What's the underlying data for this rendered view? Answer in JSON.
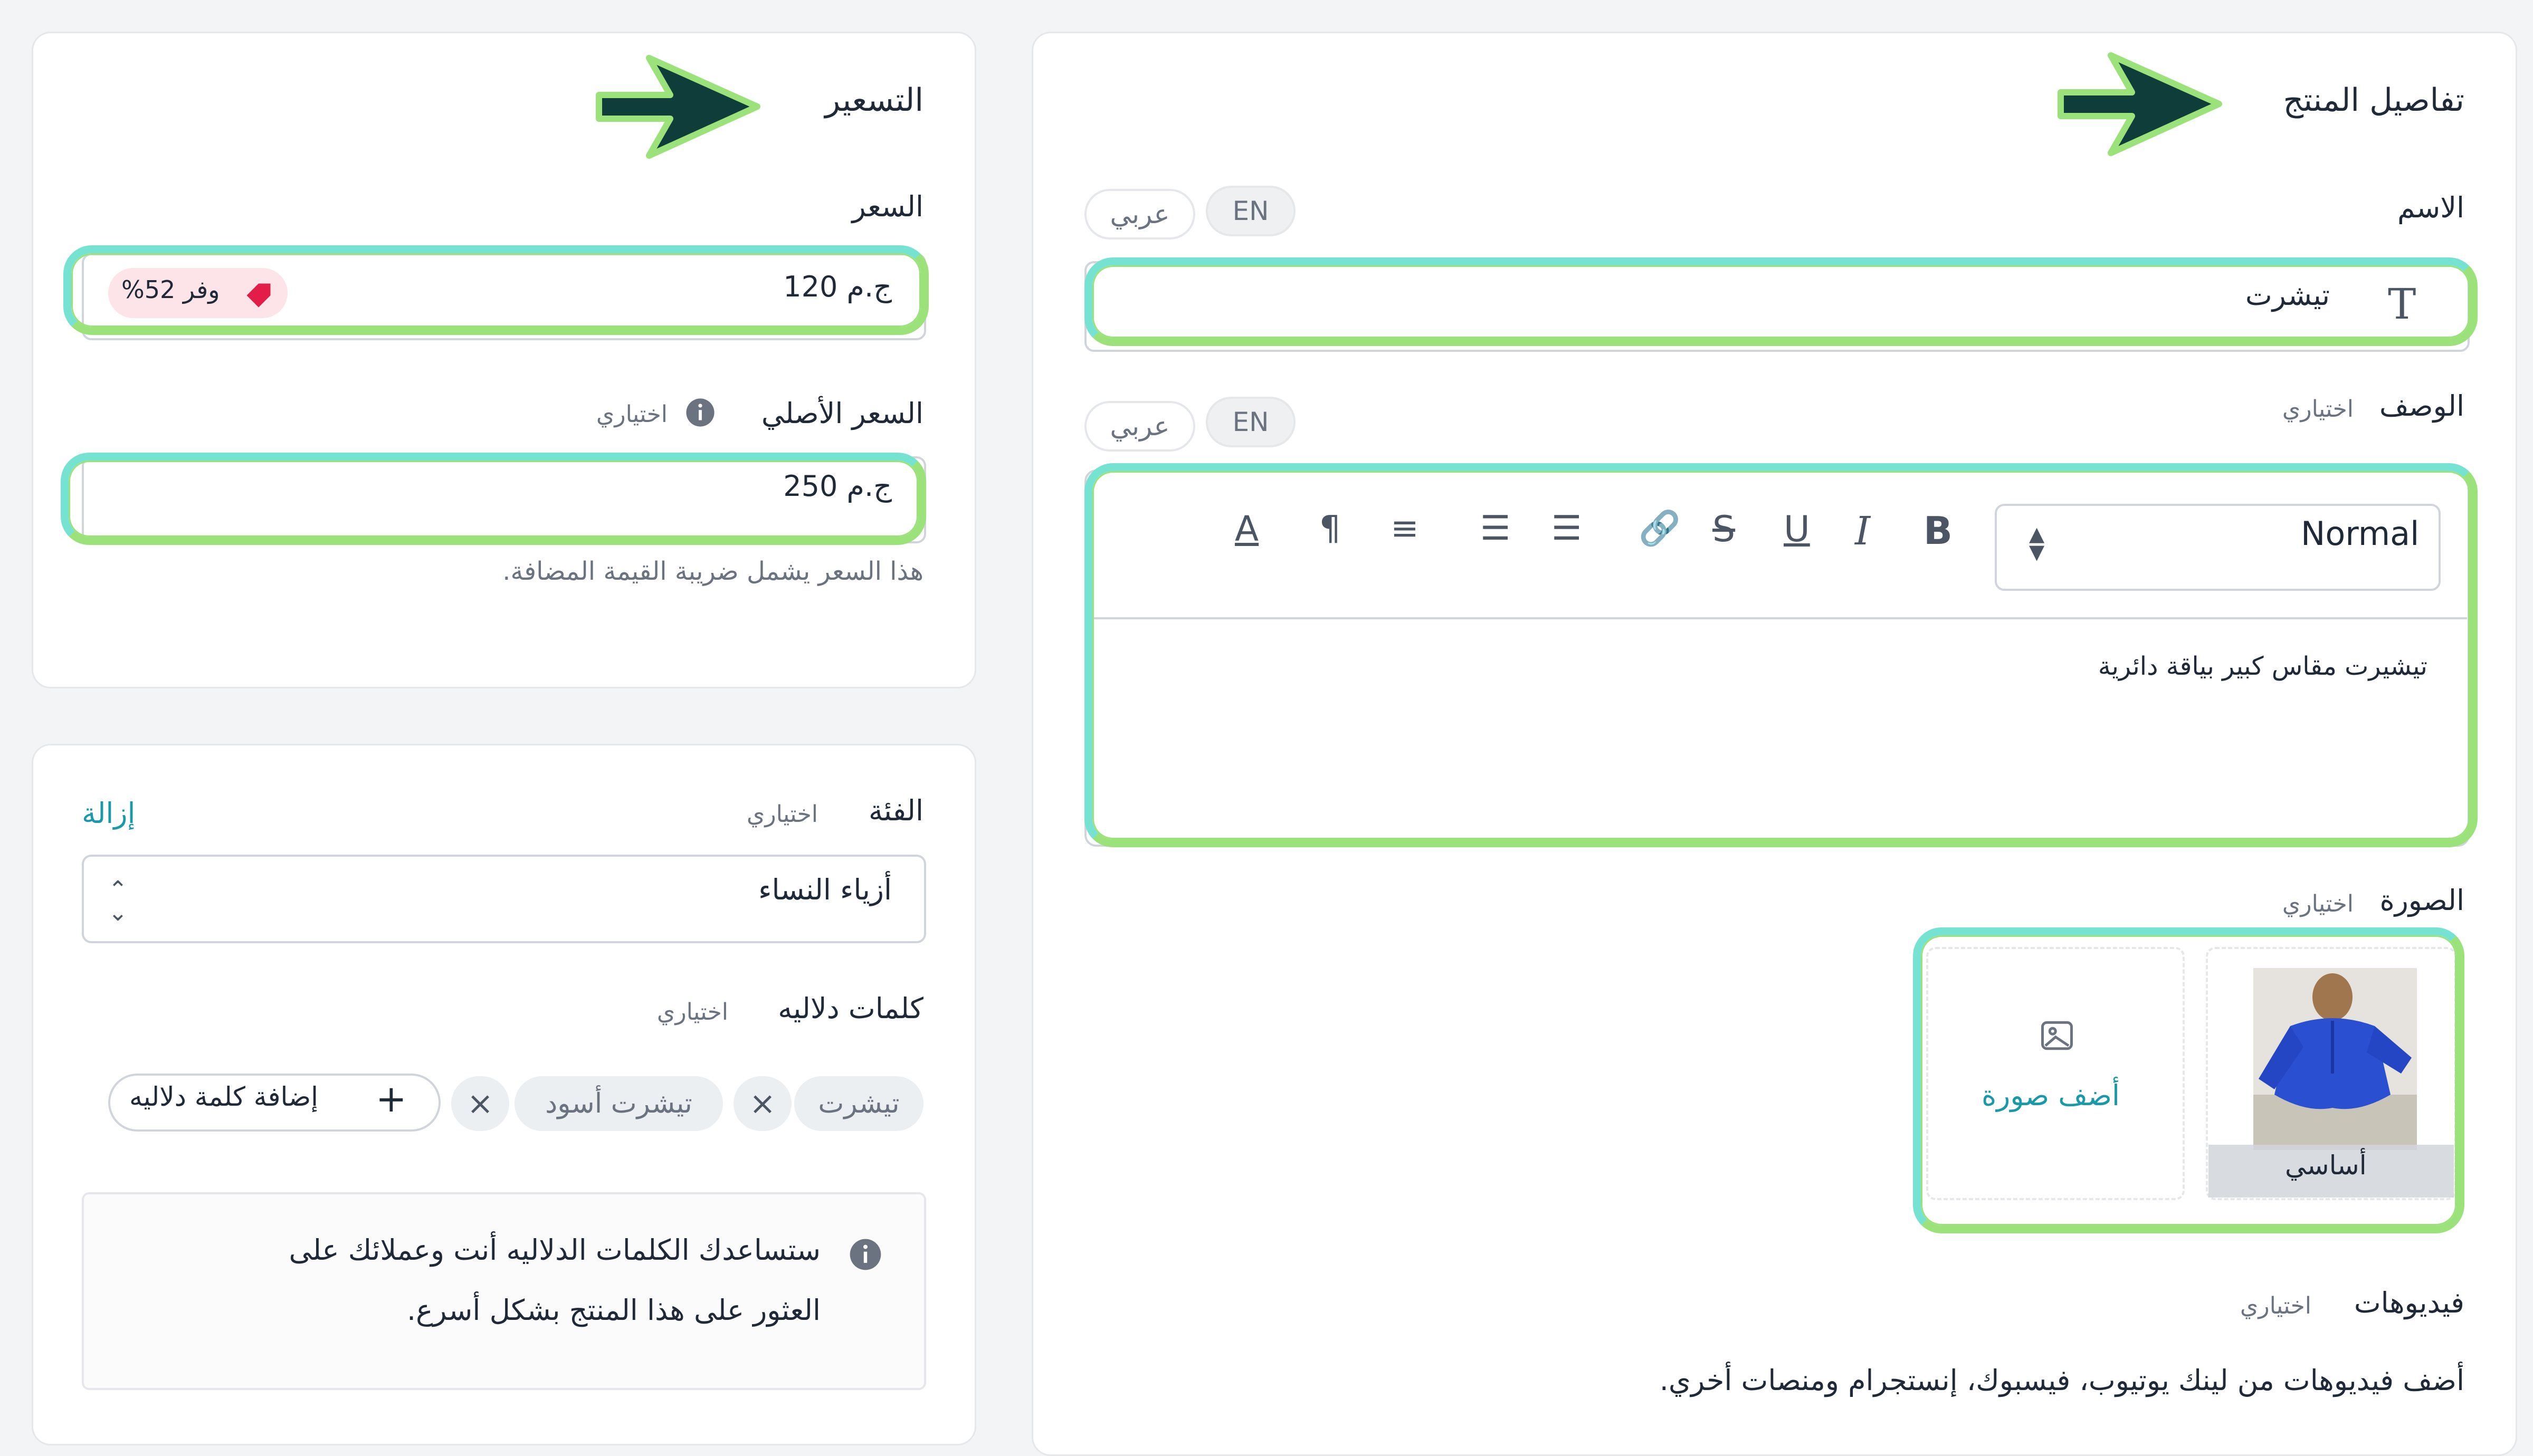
{
  "product_details": {
    "title": "تفاصيل المنتج",
    "name": {
      "label": "الاسم",
      "lang_en": "EN",
      "lang_ar": "عربي",
      "value": "تيشرت"
    },
    "description": {
      "label": "الوصف",
      "optional": "اختياري",
      "lang_en": "EN",
      "lang_ar": "عربي",
      "format_select": "Normal",
      "text": "تيشيرت مقاس كبير بياقة دائرية"
    },
    "image": {
      "label": "الصورة",
      "optional": "اختياري",
      "primary_caption": "أساسي",
      "add_image": "أضف صورة"
    },
    "videos": {
      "label": "فيديوهات",
      "optional": "اختياري",
      "hint": "أضف فيديوهات من لينك يوتيوب، فيسبوك، إنستجرام ومنصات أخري."
    }
  },
  "pricing": {
    "title": "التسعير",
    "price": {
      "label": "السعر",
      "value": "ج.م 120",
      "discount_badge": "وفر 52%"
    },
    "original_price": {
      "label": "السعر الأصلي",
      "optional": "اختياري",
      "value": "ج.م 250",
      "hint": "هذا السعر يشمل ضريبة القيمة المضافة."
    }
  },
  "category": {
    "label": "الفئة",
    "optional": "اختياري",
    "remove": "إزالة",
    "value": "أزياء النساء"
  },
  "keywords": {
    "label": "كلمات دلاليه",
    "optional": "اختياري",
    "tags": [
      "تيشرت",
      "تيشرت أسود"
    ],
    "add_label": "إضافة كلمة دلاليه",
    "info_line1": "ستساعدك الكلمات الدلاليه أنت وعملائك على",
    "info_line2": "العثور على هذا المنتج بشكل أسرع."
  },
  "colors": {
    "highlight": "#7ee0c8",
    "highlight_alt": "#9be27a",
    "accent_teal": "#1a9aa8",
    "badge_bg": "#fde4e8",
    "badge_icon": "#e11d48",
    "arrow_fill": "#0f3d3a"
  }
}
